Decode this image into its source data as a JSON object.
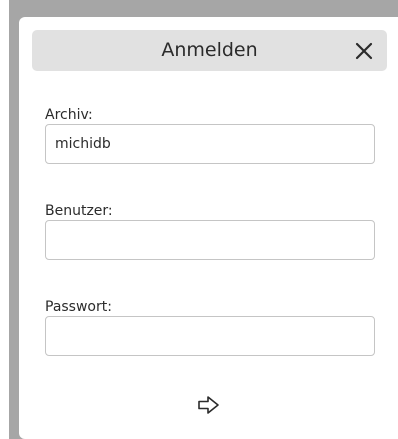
{
  "dialog": {
    "title": "Anmelden",
    "close_icon": "close-icon",
    "submit_icon": "arrow-right-icon"
  },
  "fields": {
    "archive": {
      "label": "Archiv:",
      "value": "michidb"
    },
    "user": {
      "label": "Benutzer:",
      "value": ""
    },
    "password": {
      "label": "Passwort:",
      "value": ""
    }
  },
  "colors": {
    "backdrop": "#a6a6a6",
    "header_background": "#e1e1e1",
    "dialog_background": "#ffffff",
    "input_border": "#c5c5c5",
    "text": "#2b2b2b"
  }
}
